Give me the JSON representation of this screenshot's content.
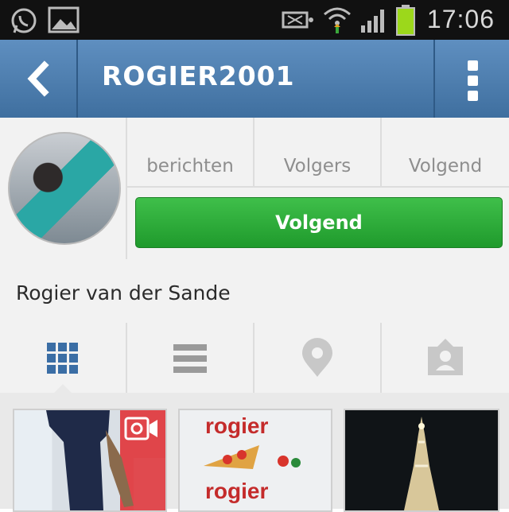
{
  "status_bar": {
    "time": "17:06",
    "icons": [
      "whatsapp-icon",
      "gallery-icon",
      "nfc-icon",
      "wifi-icon",
      "signal-icon",
      "battery-icon"
    ]
  },
  "header": {
    "title": "ROGIER2001",
    "back_icon": "chevron-left-icon",
    "menu_icon": "overflow-menu-icon"
  },
  "profile": {
    "stats": [
      {
        "label": "berichten"
      },
      {
        "label": "Volgers"
      },
      {
        "label": "Volgend"
      }
    ],
    "follow_button_label": "Volgend",
    "full_name": "Rogier van der Sande"
  },
  "tabs": [
    {
      "name": "grid-view",
      "icon": "grid-icon",
      "active": true
    },
    {
      "name": "list-view",
      "icon": "list-icon",
      "active": false
    },
    {
      "name": "map-view",
      "icon": "location-pin-icon",
      "active": false
    },
    {
      "name": "tagged-view",
      "icon": "person-tag-icon",
      "active": false
    }
  ],
  "thumbnails": {
    "photo2_text_top": "rogier",
    "photo2_text_bottom": "rogier"
  },
  "colors": {
    "header": "#4a7aab",
    "follow_button": "#2aa638",
    "active_tab": "#3b6ea5"
  }
}
